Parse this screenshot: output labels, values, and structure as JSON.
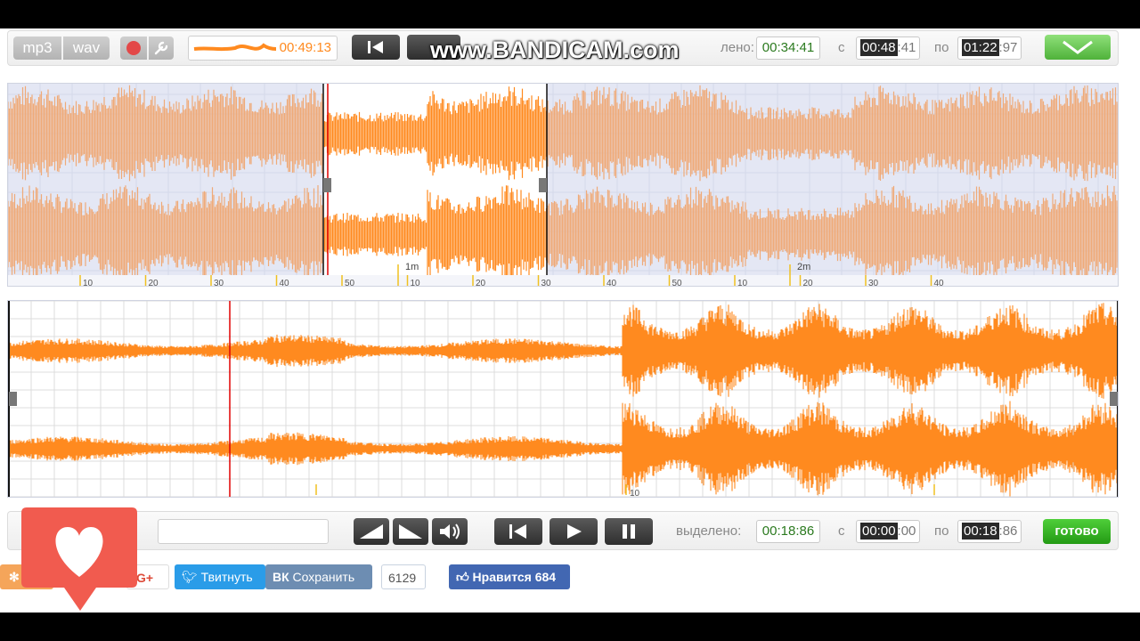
{
  "watermark": {
    "text": "www.BANDICAM.com"
  },
  "topbar": {
    "formats": [
      "mp3",
      "wav"
    ],
    "record_icon": "record-icon",
    "settings_icon": "wrench-icon",
    "clip_time": "00:49:13",
    "selected_label": "лено:",
    "selected_value": "00:34:41",
    "from_label": "с",
    "from_value_hl": "00:48",
    "from_value_rest": ":41",
    "to_label": "по",
    "to_value_hl": "01:22",
    "to_value_rest": ":97"
  },
  "overview": {
    "minute_labels": [
      "1m",
      "2m"
    ],
    "tick_labels": [
      "10",
      "20",
      "30",
      "40",
      "50",
      "10",
      "20",
      "30",
      "40",
      "50",
      "10",
      "20",
      "30",
      "40"
    ]
  },
  "detail": {
    "tick_labels": [
      "10"
    ]
  },
  "botbar": {
    "filename_value": "",
    "selected_label": "выделено:",
    "selected_value": "00:18:86",
    "from_label": "с",
    "from_value_hl": "00:00",
    "from_value_rest": ":00",
    "to_label": "по",
    "to_value_hl": "00:18",
    "to_value_rest": ":86",
    "done_label": "готово"
  },
  "social": {
    "gplus_label": "G+",
    "tweet_label": "Твитнуть",
    "vk_label": "Сохранить",
    "vk_count": "6129",
    "fb_label": "Нравится 684",
    "ok_label": "К"
  },
  "colors": {
    "wave_main": "#ff8a1f",
    "wave_light": "#efaa78",
    "playhead": "#e00000",
    "done_green": "#2aa31a"
  }
}
